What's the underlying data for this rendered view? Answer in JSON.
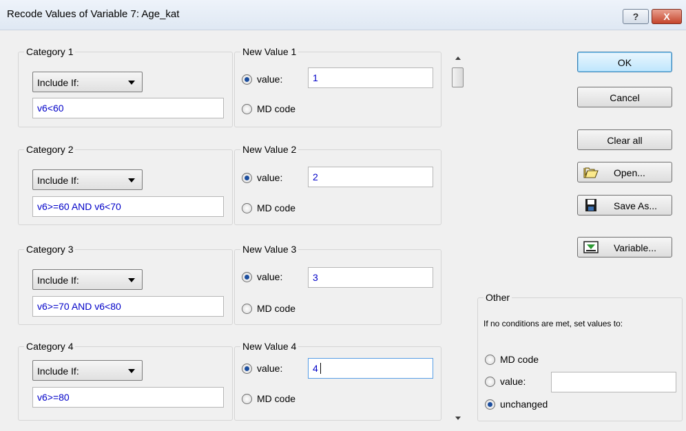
{
  "window": {
    "title": "Recode Values of Variable 7: Age_kat",
    "help_label": "?",
    "close_label": "X"
  },
  "categories": [
    {
      "legend": "Category 1",
      "select": "Include If:",
      "condition": "v6<60",
      "new_value_legend": "New Value 1",
      "value_label": "value:",
      "value": "1",
      "md_label": "MD code"
    },
    {
      "legend": "Category 2",
      "select": "Include If:",
      "condition": "v6>=60 AND v6<70",
      "new_value_legend": "New Value 2",
      "value_label": "value:",
      "value": "2",
      "md_label": "MD code"
    },
    {
      "legend": "Category 3",
      "select": "Include If:",
      "condition": "v6>=70 AND v6<80",
      "new_value_legend": "New Value 3",
      "value_label": "value:",
      "value": "3",
      "md_label": "MD code"
    },
    {
      "legend": "Category 4",
      "select": "Include If:",
      "condition": "v6>=80",
      "new_value_legend": "New Value 4",
      "value_label": "value:",
      "value": "4",
      "md_label": "MD code"
    }
  ],
  "buttons": {
    "ok": "OK",
    "cancel": "Cancel",
    "clear_all": "Clear all",
    "open": "Open...",
    "save_as": "Save As...",
    "variable": "Variable..."
  },
  "other": {
    "legend": "Other",
    "description": "If no conditions are met, set values to:",
    "md_code": "MD code",
    "value": "value:",
    "value_input": "",
    "unchanged": "unchanged",
    "selected": "unchanged"
  },
  "icons": {
    "open": "folder-open-icon",
    "save": "floppy-disk-icon",
    "variable": "variable-arrow-icon"
  },
  "colors": {
    "input_text": "#0000c8",
    "radio_selected": "#1c4e9e",
    "default_button": "#bee6fd"
  }
}
